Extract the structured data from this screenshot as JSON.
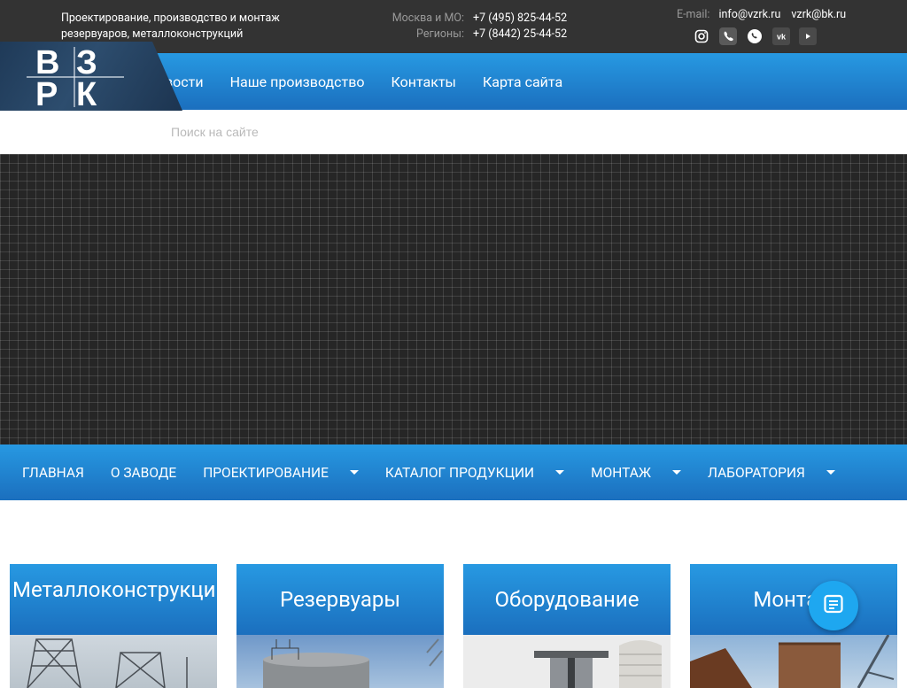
{
  "header": {
    "tagline_line1": "Проектирование, производство и монтаж",
    "tagline_line2": "резервуаров, металлоконструкций",
    "phones": [
      {
        "label": "Москва и МО:",
        "value": "+7 (495) 825-44-52"
      },
      {
        "label": "Регионы:",
        "value": "+7 (8442) 25-44-52"
      }
    ],
    "email_label": "E-mail:",
    "emails": [
      "info@vzrk.ru",
      "vzrk@bk.ru"
    ],
    "socials": [
      "instagram-icon",
      "viber-icon",
      "whatsapp-icon",
      "vk-icon",
      "youtube-icon"
    ],
    "logo_text": "ВЗРК"
  },
  "top_menu": [
    "вости",
    "Наше производство",
    "Контакты",
    "Карта сайта"
  ],
  "search": {
    "placeholder": "Поиск на сайте"
  },
  "main_menu": [
    {
      "label": "Главная",
      "dropdown": false
    },
    {
      "label": "О заводе",
      "dropdown": false
    },
    {
      "label": "Проектирование",
      "dropdown": true
    },
    {
      "label": "Каталог продукции",
      "dropdown": true
    },
    {
      "label": "Монтаж",
      "dropdown": true
    },
    {
      "label": "Лаборатория",
      "dropdown": true
    }
  ],
  "cards": [
    {
      "title": "Металлоконструкции"
    },
    {
      "title": "Резервуары"
    },
    {
      "title": "Оборудование"
    },
    {
      "title": "Монтаж"
    }
  ],
  "colors": {
    "accent_blue": "#2799e2",
    "dark": "#333333",
    "fab": "#1ea7f0"
  }
}
